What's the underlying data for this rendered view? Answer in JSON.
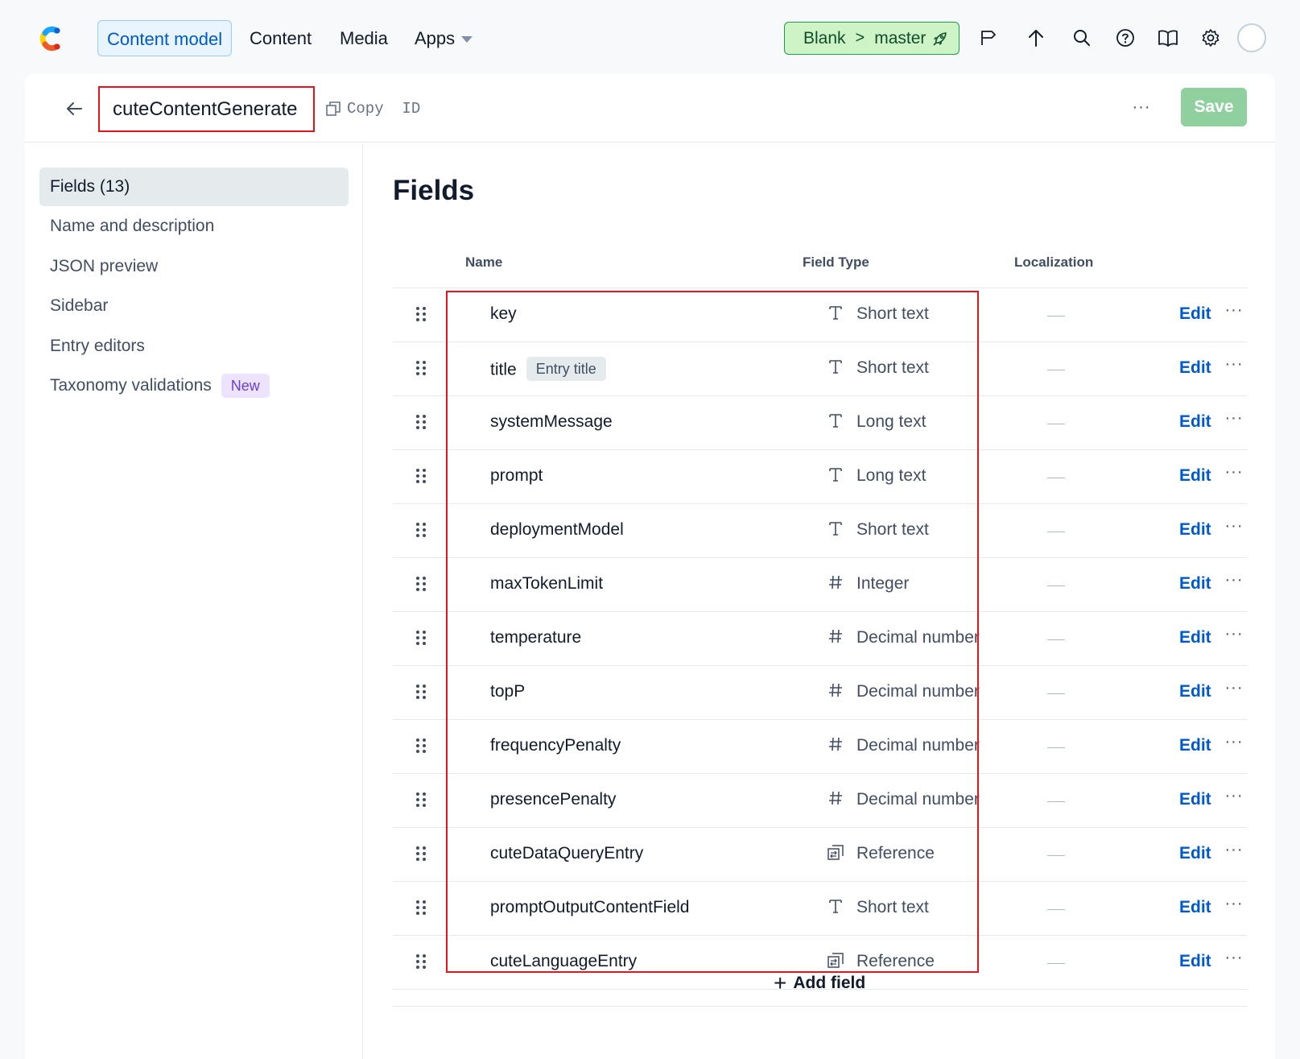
{
  "topnav": {
    "tabs": [
      {
        "label": "Content model",
        "active": true
      },
      {
        "label": "Content"
      },
      {
        "label": "Media"
      },
      {
        "label": "Apps"
      }
    ],
    "environment": {
      "space": "Blank",
      "separator": ">",
      "env": "master"
    },
    "icons": [
      "flag-icon",
      "deploy-arrow-icon",
      "search-icon",
      "help-icon",
      "book-icon",
      "settings-gear-icon",
      "user-avatar"
    ],
    "colors": {
      "accent": "#0059c8",
      "env_bg": "#cdf3c6",
      "env_border": "#1a9f4a"
    }
  },
  "header": {
    "title": "cuteContentGenerate",
    "copy_id_label": "Copy  ID",
    "more_label": "···",
    "save_label": "Save"
  },
  "sidebar": {
    "items": [
      {
        "label": "Fields (13)",
        "active": true
      },
      {
        "label": "Name and description"
      },
      {
        "label": "JSON preview"
      },
      {
        "label": "Sidebar"
      },
      {
        "label": "Entry editors"
      },
      {
        "label": "Taxonomy validations",
        "badge": "New"
      }
    ]
  },
  "main": {
    "title": "Fields",
    "columns": {
      "name": "Name",
      "field_type": "Field Type",
      "localization": "Localization"
    },
    "rows": [
      {
        "name": "key",
        "type": "Short text",
        "icon": "T"
      },
      {
        "name": "title",
        "tag": "Entry title",
        "type": "Short text",
        "icon": "T"
      },
      {
        "name": "systemMessage",
        "type": "Long text",
        "icon": "T"
      },
      {
        "name": "prompt",
        "type": "Long text",
        "icon": "T"
      },
      {
        "name": "deploymentModel",
        "type": "Short text",
        "icon": "T"
      },
      {
        "name": "maxTokenLimit",
        "type": "Integer",
        "icon": "#"
      },
      {
        "name": "temperature",
        "type": "Decimal number",
        "icon": "#"
      },
      {
        "name": "topP",
        "type": "Decimal number",
        "icon": "#"
      },
      {
        "name": "frequencyPenalty",
        "type": "Decimal number",
        "icon": "#"
      },
      {
        "name": "presencePenalty",
        "type": "Decimal number",
        "icon": "#"
      },
      {
        "name": "cuteDataQueryEntry",
        "type": "Reference",
        "icon": "ref"
      },
      {
        "name": "promptOutputContentField",
        "type": "Short text",
        "icon": "T"
      },
      {
        "name": "cuteLanguageEntry",
        "type": "Reference",
        "icon": "ref"
      }
    ],
    "edit_label": "Edit",
    "row_more_label": "···",
    "add_field_label": "Add field"
  }
}
